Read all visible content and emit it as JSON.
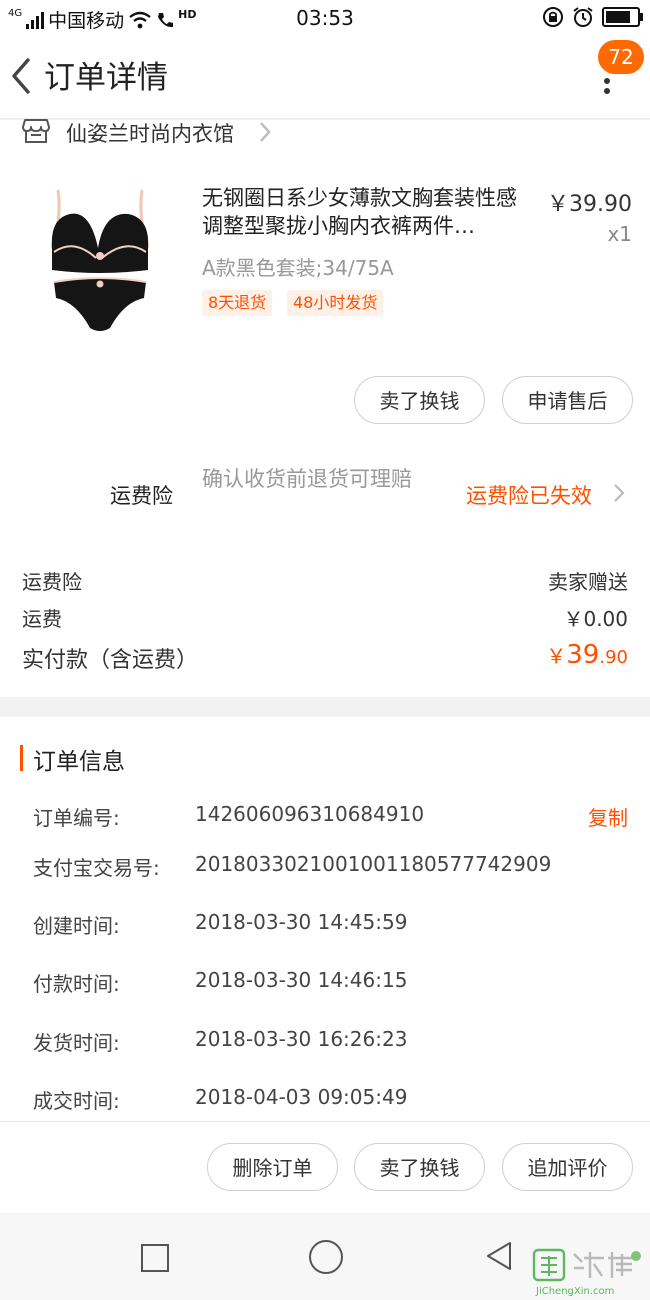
{
  "status_bar": {
    "net": "4G",
    "carrier": "中国移动",
    "hd": "HD",
    "time": "03:53"
  },
  "header": {
    "title": "订单详情",
    "badge_count": "72"
  },
  "shop": {
    "name": "仙姿兰时尚内衣馆"
  },
  "product": {
    "title": "无钢圈日系少女薄款文胸套装性感调整型聚拢小胸内衣裤两件…",
    "price": "￥39.90",
    "qty": "x1",
    "sku": "A款黑色套装;34/75A",
    "tags": [
      "8天退货",
      "48小时发货"
    ]
  },
  "item_actions": {
    "sell": "卖了换钱",
    "after_sale": "申请售后"
  },
  "insurance": {
    "label": "运费险",
    "desc": "确认收货前退货可理赔",
    "status": "运费险已失效"
  },
  "fees": {
    "rows": [
      {
        "label": "运费险",
        "value": "卖家赠送"
      },
      {
        "label": "运费",
        "value": "￥0.00"
      }
    ],
    "total_label": "实付款（含运费）",
    "total_currency": "￥",
    "total_int": "39",
    "total_dec": ".90"
  },
  "order_info": {
    "title": "订单信息",
    "copy_label": "复制",
    "rows": [
      {
        "label": "订单编号:",
        "value": "142606096310684910"
      },
      {
        "label": "支付宝交易号:",
        "value": "2018033021001001180577742909"
      },
      {
        "label": "创建时间:",
        "value": "2018-03-30 14:45:59"
      },
      {
        "label": "付款时间:",
        "value": "2018-03-30 14:46:15"
      },
      {
        "label": "发货时间:",
        "value": "2018-03-30 16:26:23"
      },
      {
        "label": "成交时间:",
        "value": "2018-04-03 09:05:49"
      }
    ]
  },
  "bottom_actions": {
    "delete": "删除订单",
    "sell": "卖了换钱",
    "review": "追加评价"
  },
  "watermark": {
    "text": "JiChengXin.com"
  },
  "colors": {
    "accent": "#ff5000",
    "badge": "#ff6a00",
    "muted": "#999999"
  }
}
